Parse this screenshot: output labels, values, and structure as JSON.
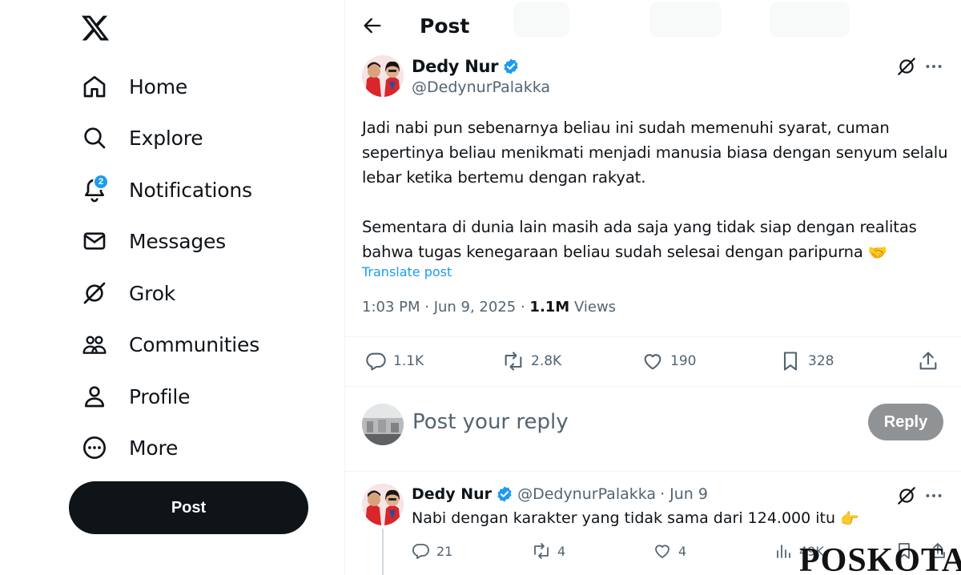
{
  "sidebar": {
    "logo": "x-logo",
    "items": [
      {
        "label": "Home",
        "icon": "home-icon"
      },
      {
        "label": "Explore",
        "icon": "search-icon"
      },
      {
        "label": "Notifications",
        "icon": "bell-icon",
        "badge": "2"
      },
      {
        "label": "Messages",
        "icon": "mail-icon"
      },
      {
        "label": "Grok",
        "icon": "grok-icon"
      },
      {
        "label": "Communities",
        "icon": "communities-icon"
      },
      {
        "label": "Profile",
        "icon": "profile-icon"
      },
      {
        "label": "More",
        "icon": "more-circle-icon"
      }
    ],
    "post_button": "Post"
  },
  "header": {
    "title": "Post"
  },
  "post": {
    "author_name": "Dedy Nur",
    "author_handle": "@DedynurPalakka",
    "paragraph_1": "Jadi nabi pun sebenarnya beliau ini sudah memenuhi syarat, cuman sepertinya beliau menikmati menjadi manusia biasa dengan senyum selalu lebar ketika bertemu dengan rakyat.",
    "paragraph_2": "Sementara di dunia lain masih ada saja yang tidak siap dengan realitas bahwa tugas kenegaraan beliau sudah selesai dengan paripurna",
    "paragraph_2_emoji": "🤝",
    "translate": "Translate post",
    "time": "1:03 PM · Jun 9, 2025 · ",
    "views_count": "1.1M",
    "views_label": " Views",
    "actions": {
      "replies": "1.1K",
      "reposts": "2.8K",
      "likes": "190",
      "bookmarks": "328"
    }
  },
  "reply_composer": {
    "placeholder": "Post your reply",
    "button": "Reply"
  },
  "reply": {
    "author_name": "Dedy Nur",
    "author_handle": "@DedynurPalakka",
    "date": "· Jun 9",
    "text": "Nabi dengan karakter yang tidak sama dari 124.000 itu",
    "text_emoji": "👉",
    "actions": {
      "replies": "21",
      "reposts": "4",
      "likes": "4",
      "views": "49K"
    }
  },
  "watermark": "POSKOTA",
  "colors": {
    "accent": "#1d9bf0",
    "text": "#0f1419",
    "muted": "#536471",
    "post_button": "#0f1419",
    "reply_button": "#8f9396"
  }
}
